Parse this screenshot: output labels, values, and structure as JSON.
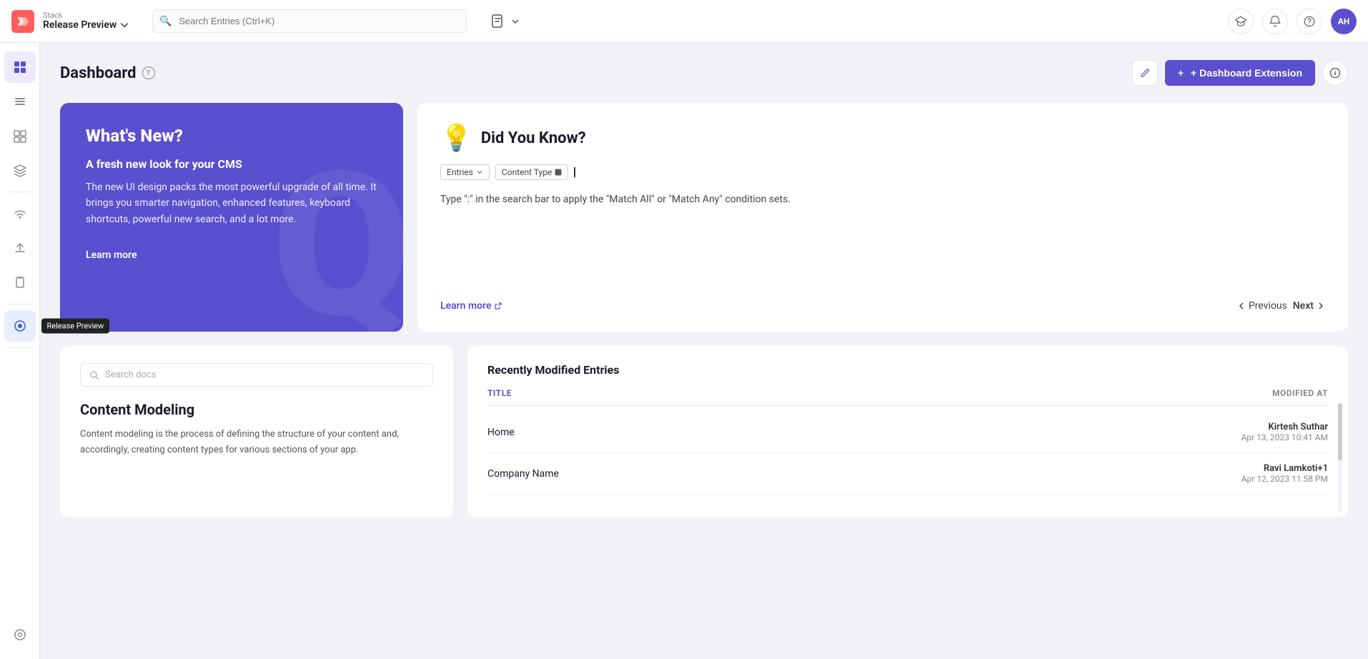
{
  "app": {
    "stack_label": "Stack",
    "release_label": "Release Preview",
    "search_placeholder": "Search Entries (Ctrl+K)",
    "avatar_initials": "AH"
  },
  "sidebar": {
    "items": [
      {
        "name": "home-icon",
        "symbol": "⊞",
        "active": true
      },
      {
        "name": "list-icon",
        "symbol": "≡",
        "active": false
      },
      {
        "name": "dashboard-icon",
        "symbol": "⧉",
        "active": false
      },
      {
        "name": "layers-icon",
        "symbol": "◫",
        "active": false
      },
      {
        "name": "divider1"
      },
      {
        "name": "wifi-icon",
        "symbol": "⊙",
        "active": false
      },
      {
        "name": "upload-icon",
        "symbol": "↑",
        "active": false
      },
      {
        "name": "clipboard-icon",
        "symbol": "📋",
        "active": false
      },
      {
        "name": "divider2"
      },
      {
        "name": "release-icon",
        "symbol": "⊙",
        "active": true,
        "tooltip": "Release Preview"
      },
      {
        "name": "divider3"
      },
      {
        "name": "grid-icon",
        "symbol": "⊞",
        "active": false
      }
    ]
  },
  "page": {
    "title": "Dashboard",
    "dashboard_extension_btn": "+ Dashboard Extension",
    "edit_btn_label": "✏"
  },
  "whats_new": {
    "title": "What's New?",
    "subtitle": "A fresh new look for your CMS",
    "body": "The new UI design packs the most powerful upgrade of all time. It brings you smarter navigation, enhanced features, keyboard shortcuts, powerful new search, and a lot more.",
    "learn_more": "Learn more"
  },
  "did_you_know": {
    "title": "Did You Know?",
    "icon": "💡",
    "tag1": "Entries",
    "tag2": "Content Type",
    "body": "Type \":\" in the search bar to apply the \"Match All\" or \"Match Any\" condition sets.",
    "learn_more": "Learn more",
    "previous_btn": "Previous",
    "next_btn": "Next"
  },
  "docs": {
    "search_placeholder": "Search docs",
    "content_title": "Content Modeling",
    "content_body": "Content modeling is the process of defining the structure of your content and, accordingly, creating content types for various sections of your app."
  },
  "recently_modified": {
    "section_title": "Recently Modified Entries",
    "col_title": "Title",
    "col_modified": "Modified At",
    "entries": [
      {
        "name": "Home",
        "modified_by": "Kirtesh Suthar",
        "modified_at": "Apr 13, 2023 10:41 AM"
      },
      {
        "name": "Company Name",
        "modified_by": "Ravi Lamkoti+1",
        "modified_at": "Apr 12, 2023 11:58 PM"
      }
    ]
  }
}
